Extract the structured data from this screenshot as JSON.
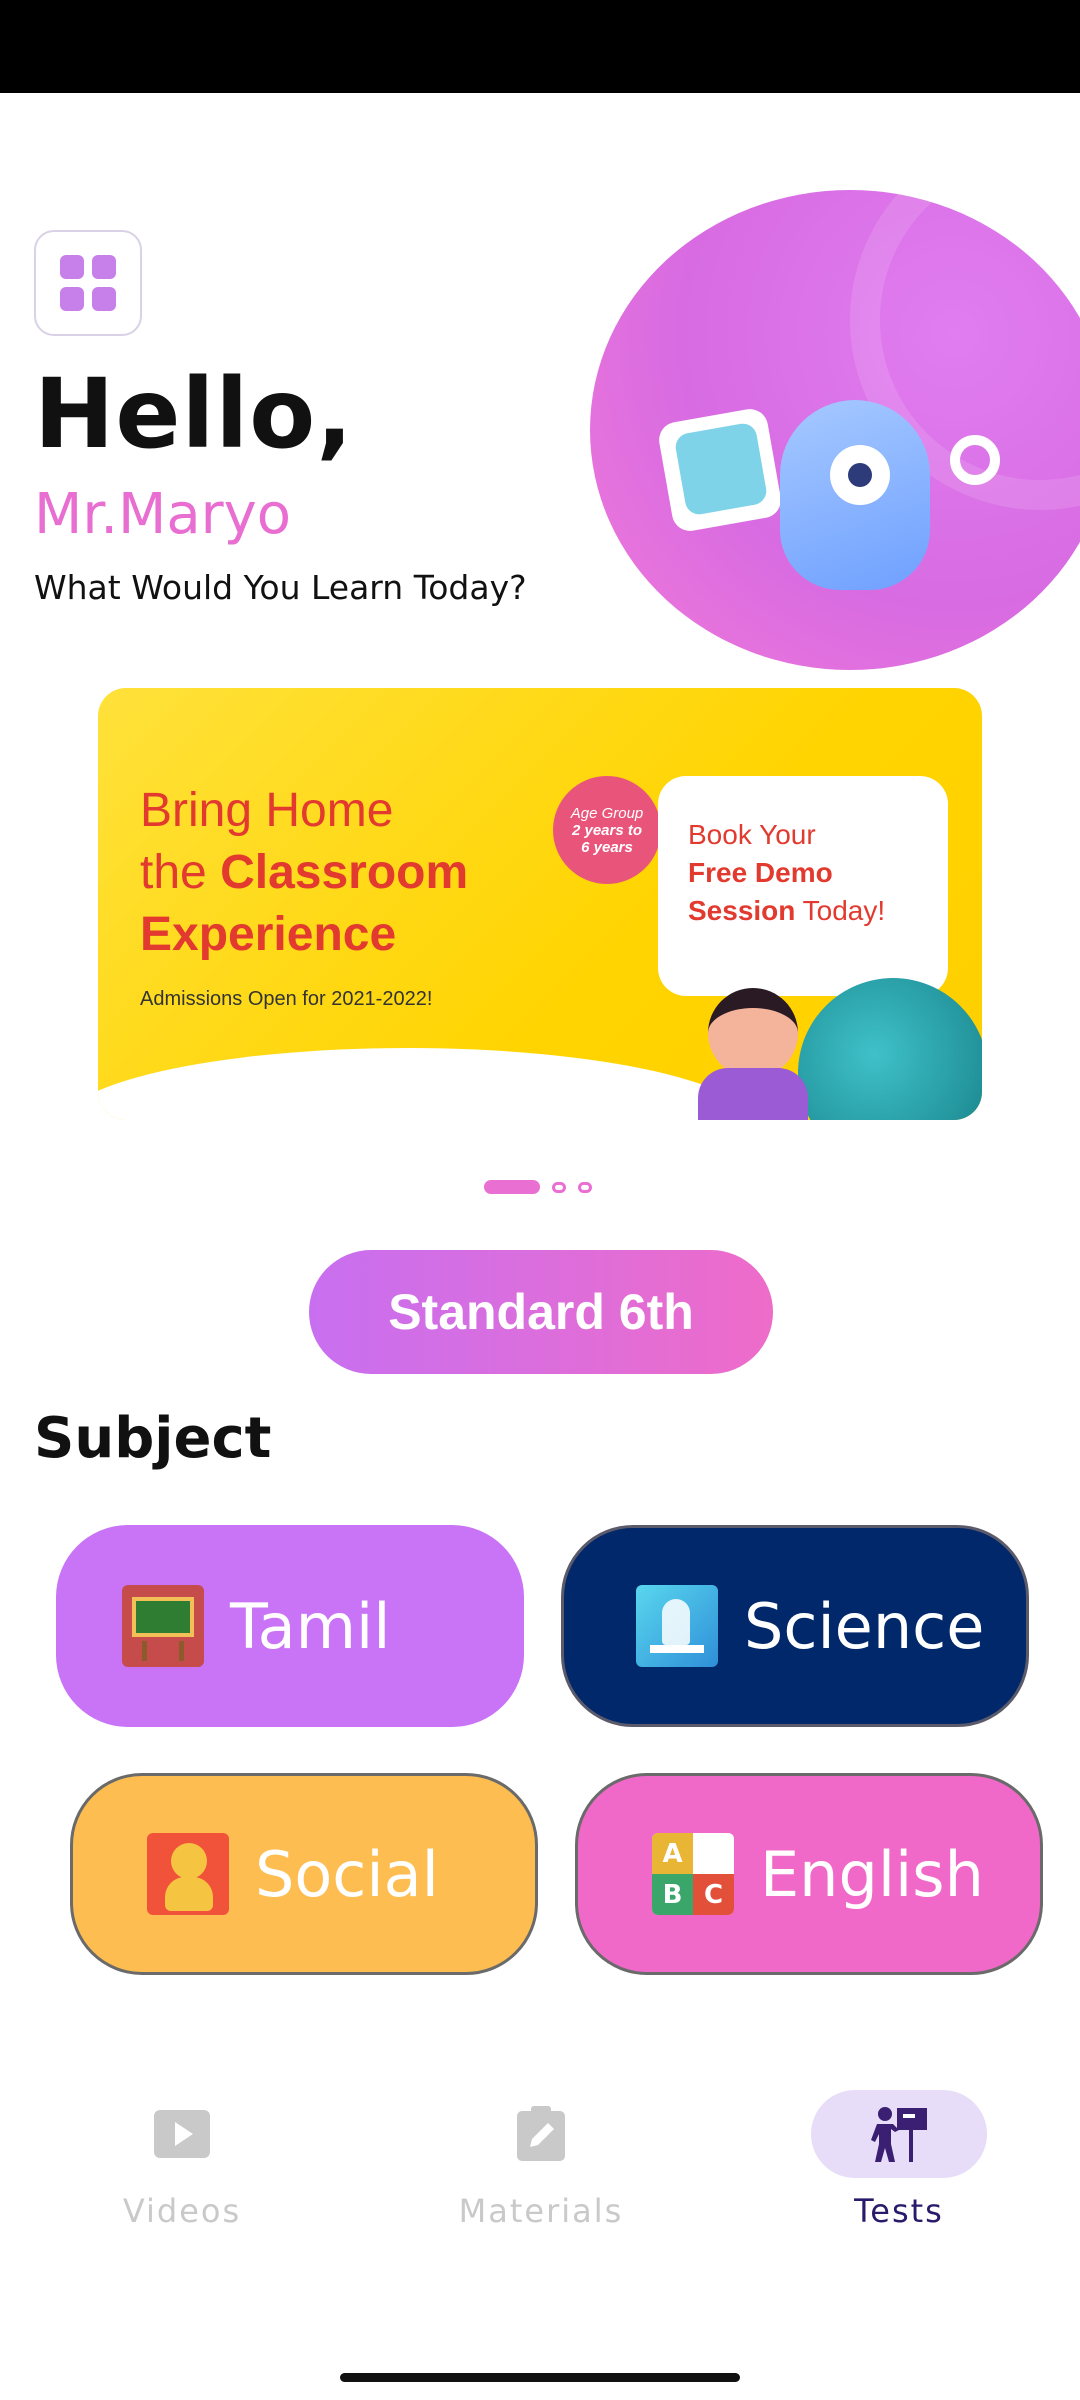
{
  "header": {
    "greeting": "Hello,",
    "username": "Mr.Maryo",
    "subtitle": "What Would You Learn Today?"
  },
  "banner": {
    "title_line1": "Bring Home",
    "title_line2_prefix": "the ",
    "title_line2_bold": "Classroom",
    "title_line3": "Experience",
    "admissions": "Admissions Open for 2021-2022!",
    "age_badge_line1": "Age Group",
    "age_badge_line2": "2 years to",
    "age_badge_line3": "6 years",
    "speech_line1": "Book Your",
    "speech_line2": "Free Demo",
    "speech_line3_bold": "Session",
    "speech_line3_rest": " Today!",
    "slide_count": 3,
    "active_slide": 1
  },
  "standard": {
    "label": "Standard 6th"
  },
  "subject_section": {
    "title": "Subject"
  },
  "subjects": [
    {
      "label": "Tamil",
      "icon": "blackboard-icon",
      "color": "#c973f6"
    },
    {
      "label": "Science",
      "icon": "microscope-icon",
      "color": "#00286b"
    },
    {
      "label": "Social",
      "icon": "historic-figure-icon",
      "color": "#fdbd50"
    },
    {
      "label": "English",
      "icon": "abc-blocks-icon",
      "color": "#f069c8"
    }
  ],
  "english_blocks": [
    "A",
    "",
    "B",
    "C"
  ],
  "nav": {
    "items": [
      {
        "label": "Videos",
        "icon": "play-video-icon",
        "active": false
      },
      {
        "label": "Materials",
        "icon": "clipboard-edit-icon",
        "active": false
      },
      {
        "label": "Tests",
        "icon": "teacher-board-icon",
        "active": true
      }
    ]
  },
  "colors": {
    "accent_pink": "#ea6fd2",
    "accent_purple": "#c86ff0",
    "active_nav_bg": "#e7ddf8"
  }
}
